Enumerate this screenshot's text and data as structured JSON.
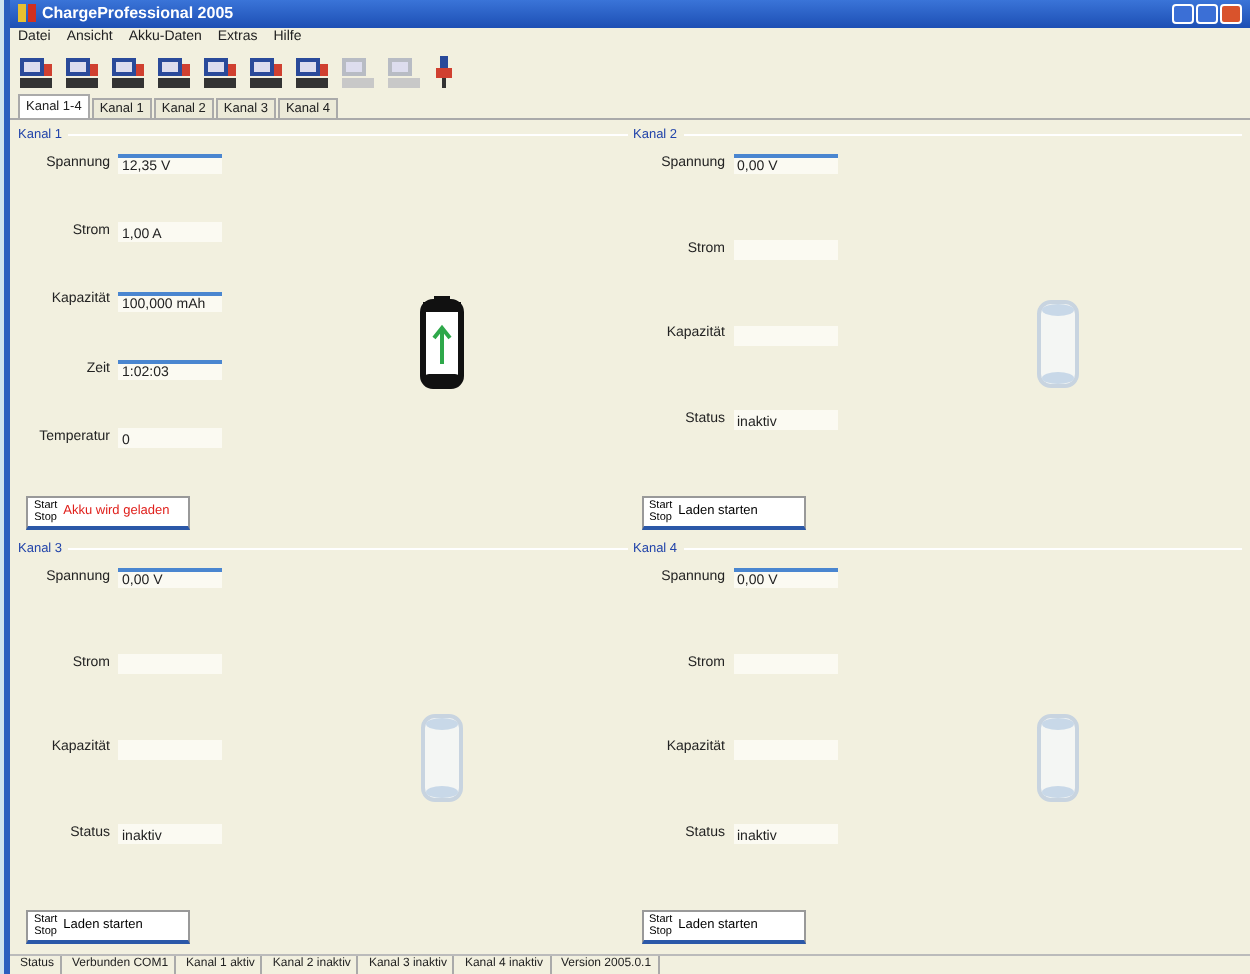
{
  "window": {
    "title": "ChargeProfessional 2005"
  },
  "menu": [
    "Datei",
    "Ansicht",
    "Akku-Daten",
    "Extras",
    "Hilfe"
  ],
  "toolbar": [
    {
      "disabled": false
    },
    {
      "disabled": false
    },
    {
      "disabled": false
    },
    {
      "disabled": false
    },
    {
      "disabled": false
    },
    {
      "disabled": false
    },
    {
      "disabled": false
    },
    {
      "disabled": true
    },
    {
      "disabled": true
    },
    {
      "disabled": false
    }
  ],
  "tabs": [
    {
      "label": "Kanal 1-4",
      "selected": true
    },
    {
      "label": "Kanal 1",
      "selected": false
    },
    {
      "label": "Kanal 2",
      "selected": false
    },
    {
      "label": "Kanal 3",
      "selected": false
    },
    {
      "label": "Kanal 4",
      "selected": false
    }
  ],
  "panels": [
    {
      "title": "Kanal 1",
      "active": true,
      "fields": [
        {
          "label": "Spannung",
          "value": "12,35 V",
          "edited": true
        },
        {
          "label": "Strom",
          "value": "1,00 A",
          "edited": false
        },
        {
          "label": "Kapazität",
          "value": "100,000 mAh",
          "edited": true
        },
        {
          "label": "Zeit",
          "value": "1:02:03",
          "edited": true
        },
        {
          "label": "Temperatur",
          "value": "0",
          "edited": false
        }
      ],
      "button": {
        "top": "Start",
        "bottom": "Stop",
        "caption": "Akku wird geladen",
        "alert": true
      }
    },
    {
      "title": "Kanal 2",
      "active": false,
      "fields": [
        {
          "label": "Spannung",
          "value": "0,00 V",
          "edited": true
        },
        {
          "label": "Strom",
          "edited": false
        },
        {
          "label": "Kapazität",
          "edited": false
        },
        {
          "label": "Status",
          "value": "inaktiv",
          "edited": false
        }
      ],
      "button": {
        "top": "Start",
        "bottom": "Stop",
        "caption": "Laden starten",
        "alert": false
      }
    },
    {
      "title": "Kanal 3",
      "active": false,
      "fields": [
        {
          "label": "Spannung",
          "value": "0,00 V",
          "edited": true
        },
        {
          "label": "Strom",
          "edited": false
        },
        {
          "label": "Kapazität",
          "edited": false
        },
        {
          "label": "Status",
          "value": "inaktiv",
          "edited": false
        }
      ],
      "button": {
        "top": "Start",
        "bottom": "Stop",
        "caption": "Laden starten",
        "alert": false
      }
    },
    {
      "title": "Kanal 4",
      "active": false,
      "fields": [
        {
          "label": "Spannung",
          "value": "0,00 V",
          "edited": true
        },
        {
          "label": "Strom",
          "edited": false
        },
        {
          "label": "Kapazität",
          "edited": false
        },
        {
          "label": "Status",
          "value": "inaktiv",
          "edited": false
        }
      ],
      "button": {
        "top": "Start",
        "bottom": "Stop",
        "caption": "Laden starten",
        "alert": false
      }
    }
  ],
  "status_bar": [
    "Status",
    "Verbunden COM1",
    "Kanal 1 aktiv",
    "Kanal 2 inaktiv",
    "Kanal 3 inaktiv",
    "Kanal 4 inaktiv",
    "Version 2005.0.1"
  ]
}
